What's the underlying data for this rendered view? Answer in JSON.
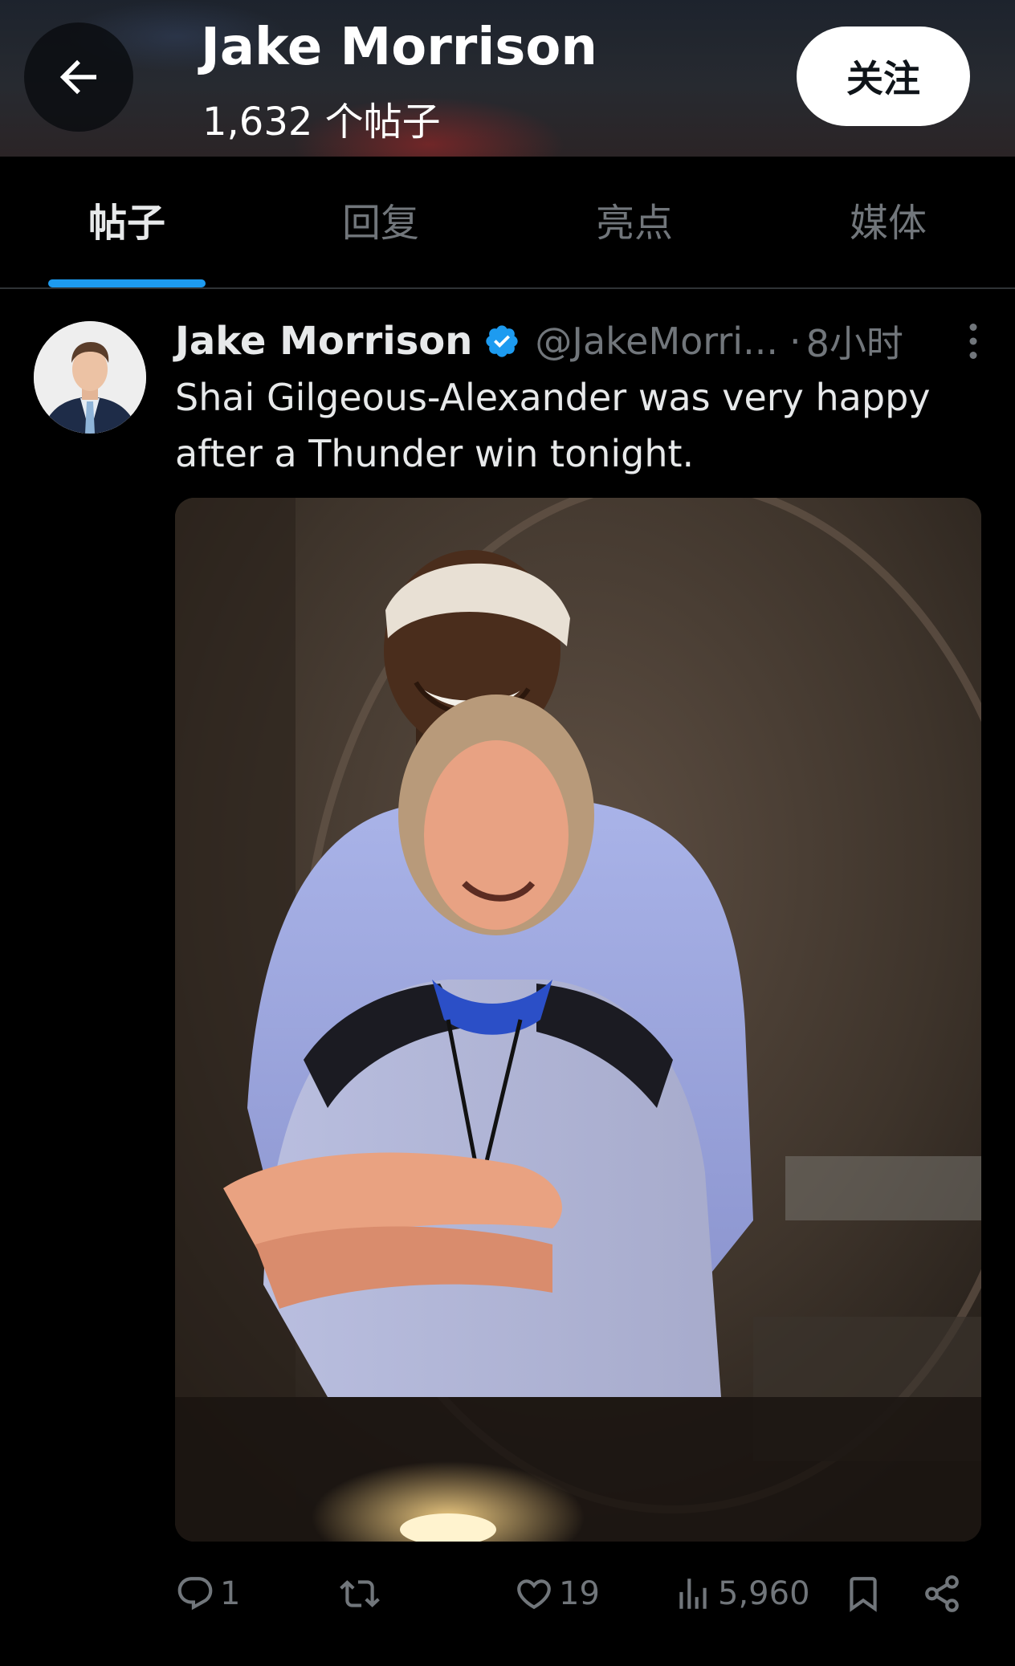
{
  "header": {
    "back_icon": "arrow-left-icon",
    "profile_name": "Jake Morrison",
    "post_count": "1,632 个帖子",
    "follow_label": "关注"
  },
  "tabs": [
    {
      "label": "帖子",
      "active": true
    },
    {
      "label": "回复",
      "active": false
    },
    {
      "label": "亮点",
      "active": false
    },
    {
      "label": "媒体",
      "active": false
    }
  ],
  "post": {
    "author_name": "Jake Morrison",
    "verified": true,
    "handle": "@JakeMorri...",
    "separator": "·",
    "time": "8小时",
    "text": "Shai Gilgeous-Alexander was very happy after a Thunder win tonight.",
    "media_icon": "photo",
    "stats": {
      "replies": "1",
      "reposts": "",
      "likes": "19",
      "views": "5,960"
    }
  },
  "colors": {
    "accent": "#1d9bf0",
    "background": "#000000",
    "text_primary": "#e7e9ea",
    "text_secondary": "#71767b"
  }
}
